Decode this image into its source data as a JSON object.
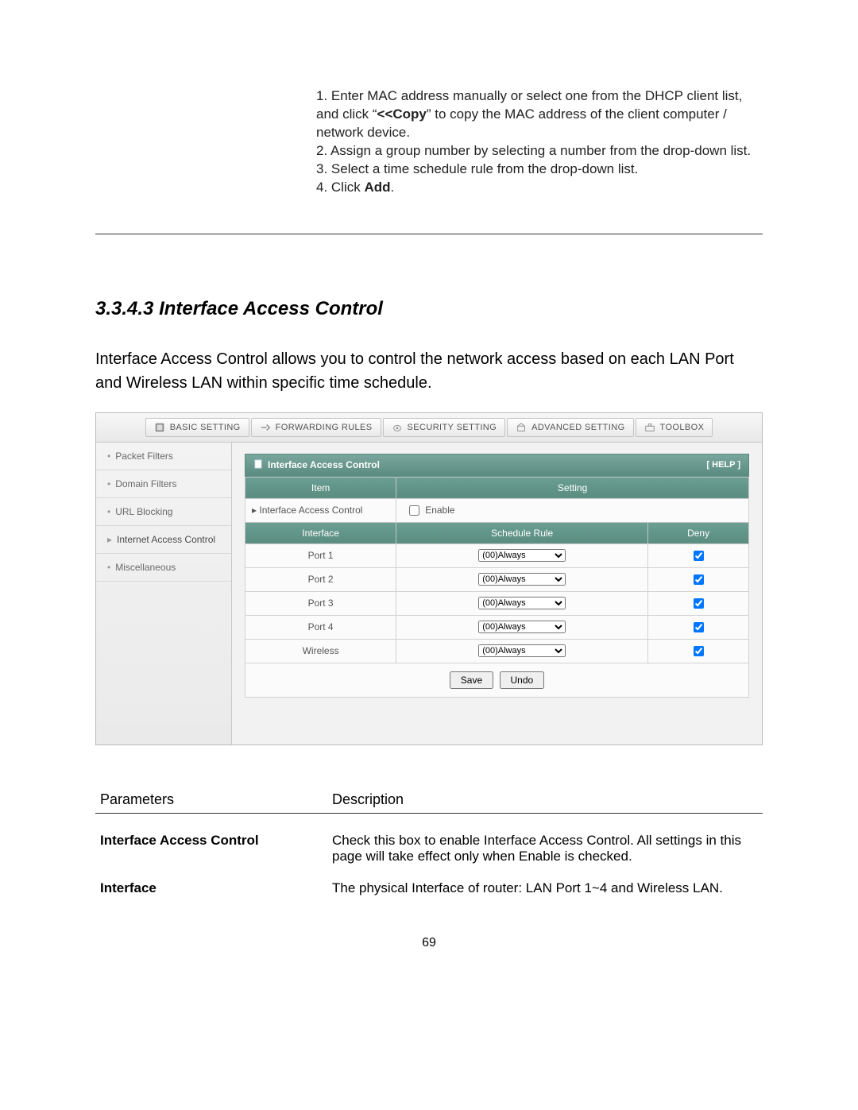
{
  "intro": {
    "line1a": "1. Enter MAC address manually or select one from the DHCP client list, and click “",
    "copy_bold": "<<Copy",
    "line1b": "” to copy the MAC address of the client computer / network device.",
    "line2": "2. Assign a group number by selecting a number from the drop-down list.",
    "line3": "3. Select a time schedule rule from the drop-down list.",
    "line4a": "4. Click ",
    "line4_bold": "Add",
    "line4b": "."
  },
  "section": {
    "title": "3.3.4.3 Interface Access Control",
    "desc": "Interface Access Control allows you to control the network access based on each LAN Port and Wireless LAN within specific time schedule."
  },
  "ui": {
    "tabs": [
      "BASIC SETTING",
      "FORWARDING RULES",
      "SECURITY SETTING",
      "ADVANCED SETTING",
      "TOOLBOX"
    ],
    "sidebar": [
      "Packet Filters",
      "Domain Filters",
      "URL Blocking",
      "Internet Access Control",
      "Miscellaneous"
    ],
    "panel_title": "Interface Access Control",
    "help": "[ HELP ]",
    "header_item": "Item",
    "header_setting": "Setting",
    "enable_row_label": "Interface Access Control",
    "enable_label": "Enable",
    "header_interface": "Interface",
    "header_schedule": "Schedule Rule",
    "header_deny": "Deny",
    "rows": [
      {
        "iface": "Port 1",
        "rule": "(00)Always",
        "deny": true
      },
      {
        "iface": "Port 2",
        "rule": "(00)Always",
        "deny": true
      },
      {
        "iface": "Port 3",
        "rule": "(00)Always",
        "deny": true
      },
      {
        "iface": "Port 4",
        "rule": "(00)Always",
        "deny": true
      },
      {
        "iface": "Wireless",
        "rule": "(00)Always",
        "deny": true
      }
    ],
    "save": "Save",
    "undo": "Undo"
  },
  "params": {
    "col1": "Parameters",
    "col2": "Description",
    "rows": [
      {
        "label": "Interface Access Control",
        "desc": "Check this box to enable Interface Access Control. All settings in this page will take effect only when Enable is checked."
      },
      {
        "label": "Interface",
        "desc": "The physical Interface of router: LAN Port 1~4 and Wireless LAN."
      }
    ]
  },
  "page_number": "69"
}
